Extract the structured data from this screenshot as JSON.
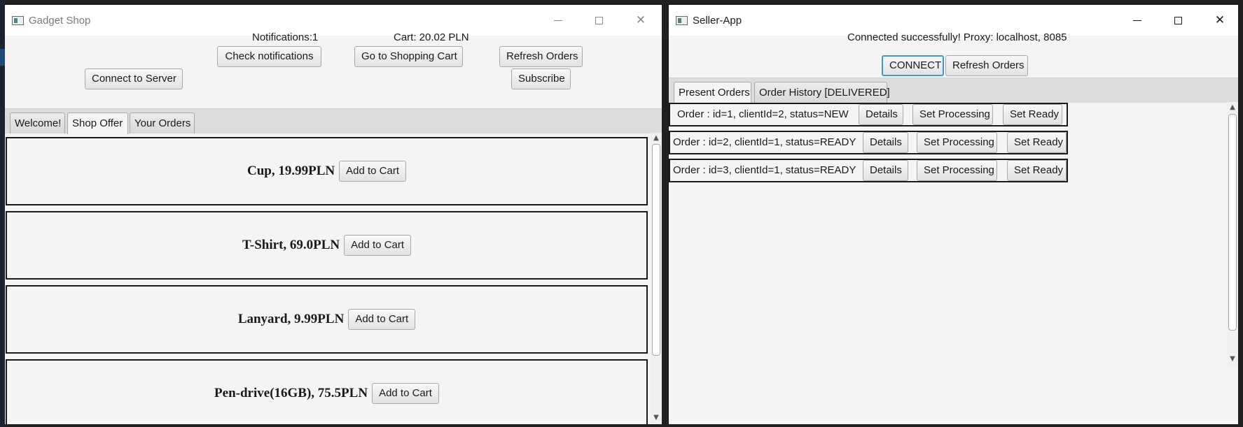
{
  "gadget_shop": {
    "title": "Gadget Shop",
    "notifications_label": "Notifications:1",
    "cart_label": "Cart: 20.02 PLN",
    "buttons": {
      "check_notifications": "Check notifications",
      "go_to_cart": "Go to Shopping Cart",
      "refresh_orders": "Refresh Orders",
      "connect_to_server": "Connect to Server",
      "subscribe": "Subscribe"
    },
    "tabs": [
      {
        "label": "Welcome!"
      },
      {
        "label": "Shop Offer"
      },
      {
        "label": "Your Orders"
      }
    ],
    "active_tab": "Shop Offer",
    "products": [
      {
        "name": "Cup, 19.99PLN",
        "button": "Add to Cart"
      },
      {
        "name": "T-Shirt, 69.0PLN",
        "button": "Add to Cart"
      },
      {
        "name": "Lanyard, 9.99PLN",
        "button": "Add to Cart"
      },
      {
        "name": "Pen-drive(16GB), 75.5PLN",
        "button": "Add to Cart"
      }
    ]
  },
  "seller_app": {
    "title": "Seller-App",
    "status": "Connected successfully! Proxy: localhost, 8085",
    "buttons": {
      "connect": "CONNECT",
      "refresh_orders": "Refresh Orders"
    },
    "tabs": [
      {
        "label": "Present Orders"
      },
      {
        "label": "Order History [DELIVERED]"
      }
    ],
    "active_tab": "Present Orders",
    "orders": [
      {
        "text": "Order : id=1, clientId=2, status=NEW",
        "details": "Details",
        "processing": "Set Processing",
        "ready": "Set Ready"
      },
      {
        "text": "Order : id=2, clientId=1, status=READY",
        "details": "Details",
        "processing": "Set Processing",
        "ready": "Set Ready"
      },
      {
        "text": "Order : id=3, clientId=1, status=READY",
        "details": "Details",
        "processing": "Set Processing",
        "ready": "Set Ready"
      }
    ]
  },
  "colors": {
    "focus_border": "#3a9ad9",
    "window_bg": "#f4f4f4",
    "tab_strip": "#dcdcdc",
    "desktop": "#202020"
  }
}
